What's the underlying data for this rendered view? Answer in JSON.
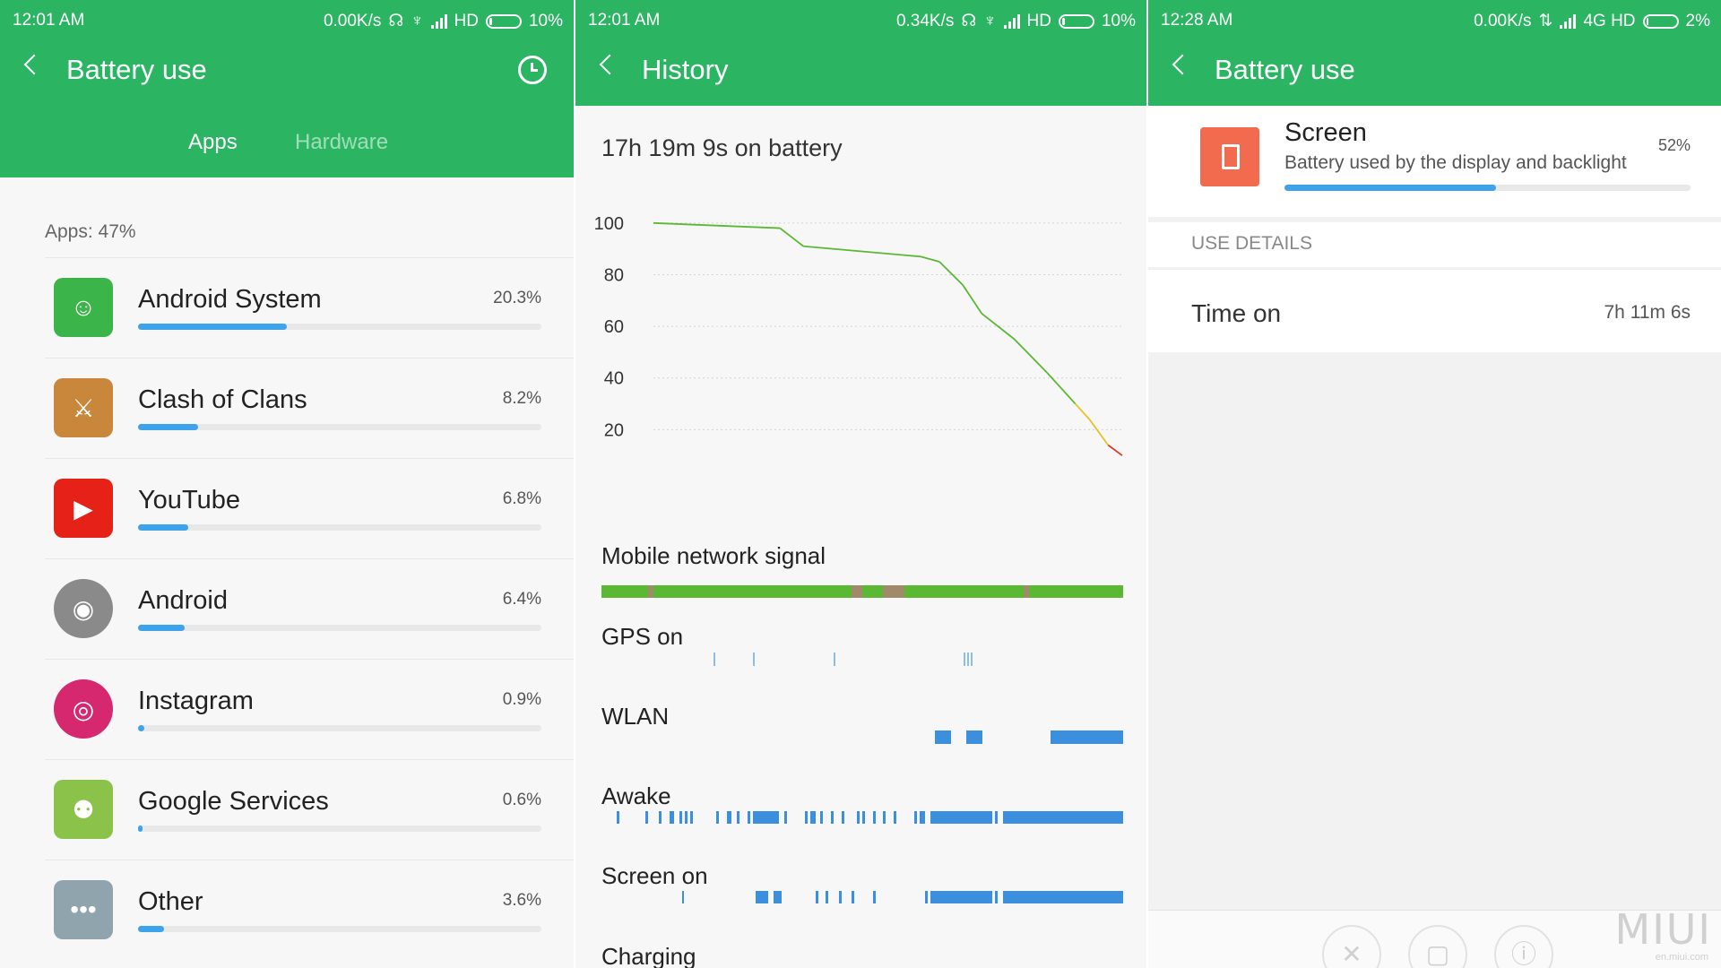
{
  "panel1": {
    "status": {
      "time": "12:01 AM",
      "speed": "0.00K/s",
      "network": "HD",
      "battery": "10%",
      "battery_fraction": 0.1
    },
    "title": "Battery use",
    "tabs": [
      {
        "label": "Apps",
        "active": true
      },
      {
        "label": "Hardware",
        "active": false
      }
    ],
    "section_label": "Apps: 47%",
    "apps": [
      {
        "name": "Android System",
        "pct": "20.3%",
        "fraction": 0.203,
        "icon": "android-system-icon",
        "color": "#3bb54a"
      },
      {
        "name": "Clash of Clans",
        "pct": "8.2%",
        "fraction": 0.082,
        "icon": "clash-of-clans-icon",
        "color": "#c9873b"
      },
      {
        "name": "YouTube",
        "pct": "6.8%",
        "fraction": 0.068,
        "icon": "youtube-icon",
        "color": "#e62117"
      },
      {
        "name": "Android",
        "pct": "6.4%",
        "fraction": 0.064,
        "icon": "android-icon",
        "color": "#8a8a8a"
      },
      {
        "name": "Instagram",
        "pct": "0.9%",
        "fraction": 0.009,
        "icon": "instagram-icon",
        "color": "#d6286f"
      },
      {
        "name": "Google Services",
        "pct": "0.6%",
        "fraction": 0.006,
        "icon": "google-services-icon",
        "color": "#8bc34a"
      },
      {
        "name": "Other",
        "pct": "3.6%",
        "fraction": 0.036,
        "icon": "other-apps-icon",
        "color": "#90a4ae"
      }
    ]
  },
  "panel2": {
    "status": {
      "time": "12:01 AM",
      "speed": "0.34K/s",
      "network": "HD",
      "battery": "10%",
      "battery_fraction": 0.1
    },
    "title": "History",
    "battery_time": "17h 19m 9s on battery",
    "sections": {
      "mobile_signal": "Mobile network signal",
      "gps": "GPS on",
      "wlan": "WLAN",
      "awake": "Awake",
      "screen_on": "Screen on",
      "charging": "Charging"
    },
    "colors": {
      "good": "#5bb832",
      "medium": "#e5c22a",
      "low": "#e03a2e",
      "lane": "#3c8fdd",
      "signal": "#5bb832",
      "signal_dim": "#a08a6a"
    },
    "timelines": {
      "mobile_signal_dim": [
        [
          0.09,
          0.1
        ],
        [
          0.48,
          0.5
        ],
        [
          0.54,
          0.58
        ],
        [
          0.81,
          0.82
        ]
      ],
      "gps": [
        0.215,
        0.29,
        0.445,
        0.695,
        0.701,
        0.708
      ],
      "wlan": [
        [
          0.64,
          0.67
        ],
        [
          0.7,
          0.73
        ],
        [
          0.86,
          1.0
        ]
      ],
      "awake": [
        [
          0.03,
          0.035
        ],
        [
          0.085,
          0.09
        ],
        [
          0.11,
          0.115
        ],
        [
          0.13,
          0.14
        ],
        [
          0.15,
          0.155
        ],
        [
          0.16,
          0.165
        ],
        [
          0.17,
          0.175
        ],
        [
          0.22,
          0.225
        ],
        [
          0.24,
          0.25
        ],
        [
          0.26,
          0.265
        ],
        [
          0.28,
          0.285
        ],
        [
          0.29,
          0.34
        ],
        [
          0.35,
          0.355
        ],
        [
          0.39,
          0.395
        ],
        [
          0.4,
          0.41
        ],
        [
          0.42,
          0.425
        ],
        [
          0.44,
          0.445
        ],
        [
          0.46,
          0.465
        ],
        [
          0.49,
          0.495
        ],
        [
          0.5,
          0.505
        ],
        [
          0.52,
          0.525
        ],
        [
          0.54,
          0.545
        ],
        [
          0.56,
          0.565
        ],
        [
          0.6,
          0.605
        ],
        [
          0.61,
          0.62
        ],
        [
          0.63,
          0.75
        ],
        [
          0.755,
          0.76
        ],
        [
          0.77,
          1.0
        ]
      ],
      "screen_on": [
        [
          0.155,
          0.158
        ],
        [
          0.295,
          0.32
        ],
        [
          0.33,
          0.345
        ],
        [
          0.41,
          0.415
        ],
        [
          0.43,
          0.435
        ],
        [
          0.455,
          0.46
        ],
        [
          0.48,
          0.485
        ],
        [
          0.52,
          0.525
        ],
        [
          0.62,
          0.625
        ],
        [
          0.63,
          0.75
        ],
        [
          0.755,
          0.76
        ],
        [
          0.77,
          1.0
        ]
      ]
    },
    "chart_data": {
      "type": "line",
      "title": "",
      "xlabel": "",
      "ylabel": "",
      "ylim": [
        10,
        100
      ],
      "yticks": [
        100,
        80,
        60,
        40,
        20
      ],
      "grid": true,
      "series": [
        {
          "x": [
            0,
            0.27,
            0.32,
            0.57,
            0.61,
            0.66,
            0.7,
            0.77,
            0.84,
            0.9,
            0.93,
            0.97,
            1.0
          ],
          "values": [
            100,
            98,
            91,
            87,
            85,
            76,
            65,
            55,
            42,
            30,
            24,
            14,
            10
          ]
        }
      ]
    }
  },
  "panel3": {
    "status": {
      "time": "12:28 AM",
      "speed": "0.00K/s",
      "network": "4G HD",
      "battery": "2%",
      "battery_fraction": 0.02
    },
    "title": "Battery use",
    "item": {
      "name": "Screen",
      "description": "Battery used by the display and backlight",
      "pct": "52%",
      "fraction": 0.52
    },
    "details_header": "USE DETAILS",
    "time_on_label": "Time on",
    "time_on_value": "7h 11m 6s",
    "watermark": "MIUI",
    "watermark_sub": "en.miui.com"
  }
}
